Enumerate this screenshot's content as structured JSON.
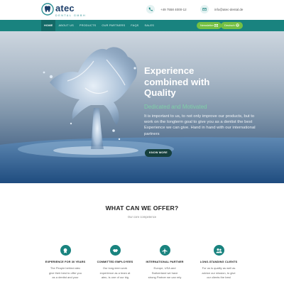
{
  "header": {
    "logo_text": "atec",
    "logo_subtext": "DENTAL GMBH",
    "phone": "+49 7558 4000-12",
    "email": "info@atec-dental.de"
  },
  "nav": {
    "items": [
      "HOME",
      "ABOUT US",
      "PRODUCTS",
      "OUR PARTNERS",
      "FAQS",
      "SALES"
    ],
    "newsletter_label": "Newsletter",
    "deutsch_label": "Deutsch"
  },
  "hero": {
    "title_line1": "Experience",
    "title_line2": "combined with",
    "title_line3": "Quality",
    "subtitle": "Dedicated and Motivated",
    "body": "It is important to us, to not only improve our products, but to work on the longterm goal to give you as a dentist the best Experience we can give. Hand in hand with our international partners",
    "button_label": "KNOW MORE"
  },
  "offer": {
    "title": "WHAT CAN WE OFFER?",
    "subtitle": "Our core competence",
    "features": [
      {
        "icon": "badge-icon",
        "title": "EXPERIENCE FOR 30 YEARS",
        "desc_l1": "The People behind atec",
        "desc_l2": "give their best to offer you",
        "desc_l3": "as a dentist and your"
      },
      {
        "icon": "handshake-icon",
        "title": "COMMITTED EMPLOYEES",
        "desc_l1": "Our long-term work",
        "desc_l2": "experience as a team at",
        "desc_l3": "atec, is one of our big"
      },
      {
        "icon": "plane-icon",
        "title": "INTERNATIONAL PARTNER",
        "desc_l1": "Europe, USA and",
        "desc_l2": "Switzerland we have",
        "desc_l3": "strong Partner we can rely"
      },
      {
        "icon": "people-icon",
        "title": "LONG-STANDING CLIENTS",
        "desc_l1": "For us is quality as well as",
        "desc_l2": "advice our mission, to give",
        "desc_l3": "our clients the best"
      }
    ]
  },
  "colors": {
    "brand_teal": "#19837f",
    "nav_active": "#136966",
    "button_green": "#74c043",
    "hero_subtitle": "#7fd0a8"
  }
}
